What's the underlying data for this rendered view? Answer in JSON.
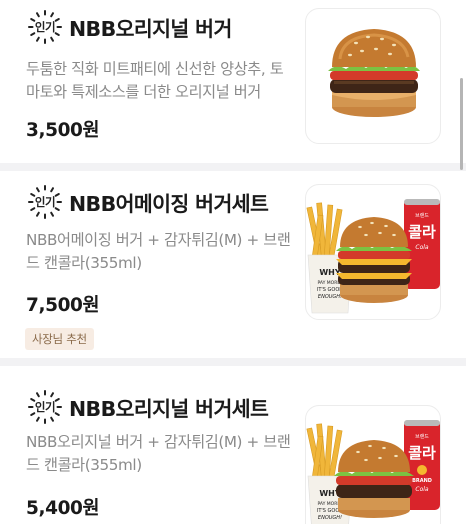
{
  "menu": {
    "items": [
      {
        "badge": "인기",
        "title": "NBB오리지널 버거",
        "description": "두툼한 직화 미트패티에 신선한 양상추, 토마토와 특제소스를 더한 오리지널 버거",
        "price": "3,500원",
        "tag": ""
      },
      {
        "badge": "인기",
        "title": "NBB어메이징 버거세트",
        "description": "NBB어메이징 버거 + 감자튀김(M) + 브랜드 캔콜라(355ml)",
        "price": "7,500원",
        "tag": "사장님 추천",
        "image_text": {
          "can_label_top": "브랜드",
          "can_label": "콜라",
          "can_label_sub": "Cola",
          "box_text": "WHY PAY MORE? IT'S GOOD ENOUGH!"
        }
      },
      {
        "badge": "인기",
        "title": "NBB오리지널 버거세트",
        "description": "NBB오리지널 버거 + 감자튀김(M) + 브랜드 캔콜라(355ml)",
        "price": "5,400원",
        "tag": "",
        "image_text": {
          "can_label_top": "브랜드",
          "can_label": "콜라",
          "can_label_sub": "Cola",
          "can_brand": "BRAND",
          "box_text": "WHY PAY MORE? IT'S GOOD ENOUGH!"
        }
      }
    ]
  },
  "colors": {
    "title": "#1a1a1a",
    "description": "#8a8a8a",
    "tag_bg": "#f7ece3",
    "tag_text": "#8a6a4a",
    "separator": "#f2f2f4",
    "can_red": "#d9242b"
  }
}
